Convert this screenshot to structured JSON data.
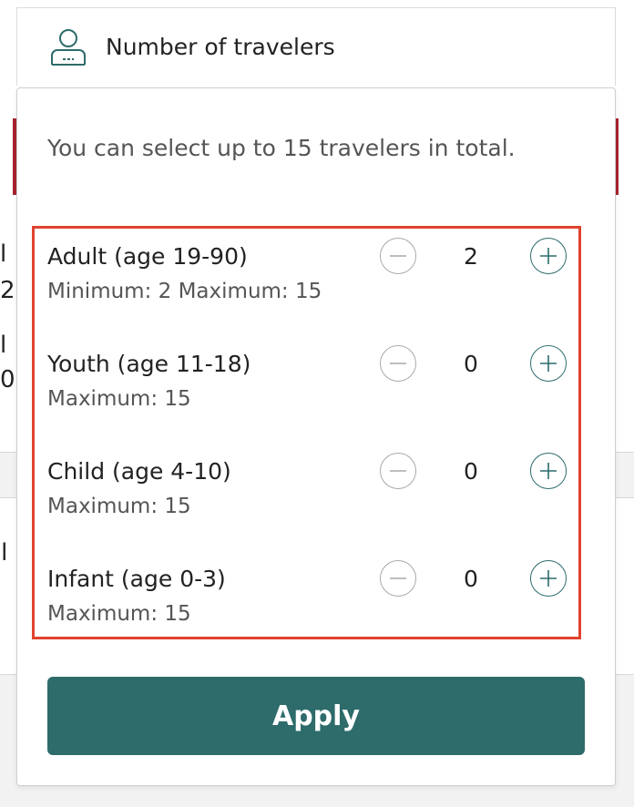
{
  "field": {
    "title": "Number of travelers",
    "icon": "person-icon"
  },
  "panel": {
    "intro": "You can select up to 15 travelers in total.",
    "rows": [
      {
        "label": "Adult (age 19-90)",
        "limits": "Minimum: 2 Maximum: 15",
        "count": "2"
      },
      {
        "label": "Youth (age 11-18)",
        "limits": "Maximum: 15",
        "count": "0"
      },
      {
        "label": "Child (age 4-10)",
        "limits": "Maximum: 15",
        "count": "0"
      },
      {
        "label": "Infant (age 0-3)",
        "limits": "Maximum: 15",
        "count": "0"
      }
    ],
    "apply_label": "Apply"
  },
  "colors": {
    "accent": "#2e6b6b",
    "highlight": "#e0432f",
    "background_alert": "#a8232e"
  },
  "background": {
    "fragments": [
      "l",
      "2",
      "l",
      "0",
      "oil"
    ]
  }
}
